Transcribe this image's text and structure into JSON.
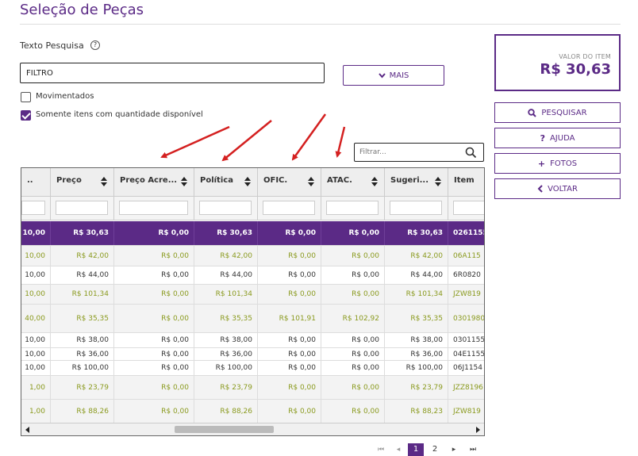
{
  "page": {
    "title": "Seleção de Peças"
  },
  "search": {
    "label": "Texto Pesquisa",
    "help_glyph": "?",
    "value": "FILTRO",
    "more_button": "MAIS"
  },
  "options": {
    "movimentados": {
      "label": "Movimentados",
      "checked": false
    },
    "somente_disponivel": {
      "label": "Somente itens com quantidade disponível",
      "checked": true
    }
  },
  "valor": {
    "label": "VALOR DO ITEM",
    "value": "R$  30,63"
  },
  "actions": {
    "pesquisar": "PESQUISAR",
    "ajuda": "AJUDA",
    "fotos": "FOTOS",
    "voltar": "VOLTAR"
  },
  "grid_filter": {
    "placeholder": "Filtrar..."
  },
  "grid": {
    "columns": [
      "..",
      "Preço",
      "Preço Acre...",
      "Política",
      "OFIC.",
      "ATAC.",
      "Sugeri...",
      "Item"
    ],
    "rows": [
      {
        "style": "sel",
        "cells": [
          "10,00",
          "R$ 30,63",
          "R$ 0,00",
          "R$ 30,63",
          "R$ 0,00",
          "R$ 0,00",
          "R$ 30,63",
          "0261155"
        ]
      },
      {
        "style": "olive",
        "cells": [
          "10,00",
          "R$ 42,00",
          "R$ 0,00",
          "R$ 42,00",
          "R$ 0,00",
          "R$ 0,00",
          "R$ 42,00",
          "06A115"
        ]
      },
      {
        "style": "dark",
        "cells": [
          "10,00",
          "R$ 44,00",
          "R$ 0,00",
          "R$ 44,00",
          "R$ 0,00",
          "R$ 0,00",
          "R$ 44,00",
          "6R0820"
        ]
      },
      {
        "style": "olive",
        "cells": [
          "10,00",
          "R$ 101,34",
          "R$ 0,00",
          "R$ 101,34",
          "R$ 0,00",
          "R$ 0,00",
          "R$ 101,34",
          "JZW819"
        ]
      },
      {
        "style": "olive",
        "cells": [
          "40,00",
          "R$ 35,35",
          "R$ 0,00",
          "R$ 35,35",
          "R$ 101,91",
          "R$ 102,92",
          "R$ 35,35",
          "0301980"
        ]
      },
      {
        "style": "dark",
        "cells": [
          "10,00",
          "R$ 38,00",
          "R$ 0,00",
          "R$ 38,00",
          "R$ 0,00",
          "R$ 0,00",
          "R$ 38,00",
          "0301155"
        ]
      },
      {
        "style": "dark",
        "cells": [
          "10,00",
          "R$ 36,00",
          "R$ 0,00",
          "R$ 36,00",
          "R$ 0,00",
          "R$ 0,00",
          "R$ 36,00",
          "04E1155"
        ]
      },
      {
        "style": "dark",
        "cells": [
          "10,00",
          "R$ 100,00",
          "R$ 0,00",
          "R$ 100,00",
          "R$ 0,00",
          "R$ 0,00",
          "R$ 100,00",
          "06J1154"
        ]
      },
      {
        "style": "olive",
        "cells": [
          "1,00",
          "R$ 23,79",
          "R$ 0,00",
          "R$ 23,79",
          "R$ 0,00",
          "R$ 0,00",
          "R$ 23,79",
          "JZZ8196"
        ]
      },
      {
        "style": "olive",
        "cells": [
          "1,00",
          "R$ 88,26",
          "R$ 0,00",
          "R$ 88,26",
          "R$ 0,00",
          "R$ 0,00",
          "R$ 88,23",
          "JZW819"
        ]
      }
    ]
  },
  "pagination": {
    "first": "⏮",
    "prev": "◂",
    "next": "▸",
    "last": "⏭",
    "pages": [
      "1",
      "2"
    ],
    "current": "1"
  },
  "annotation": {
    "arrow_color": "#d42020"
  },
  "colors": {
    "accent": "#5b2a86",
    "olive_text": "#8a9a1e"
  }
}
